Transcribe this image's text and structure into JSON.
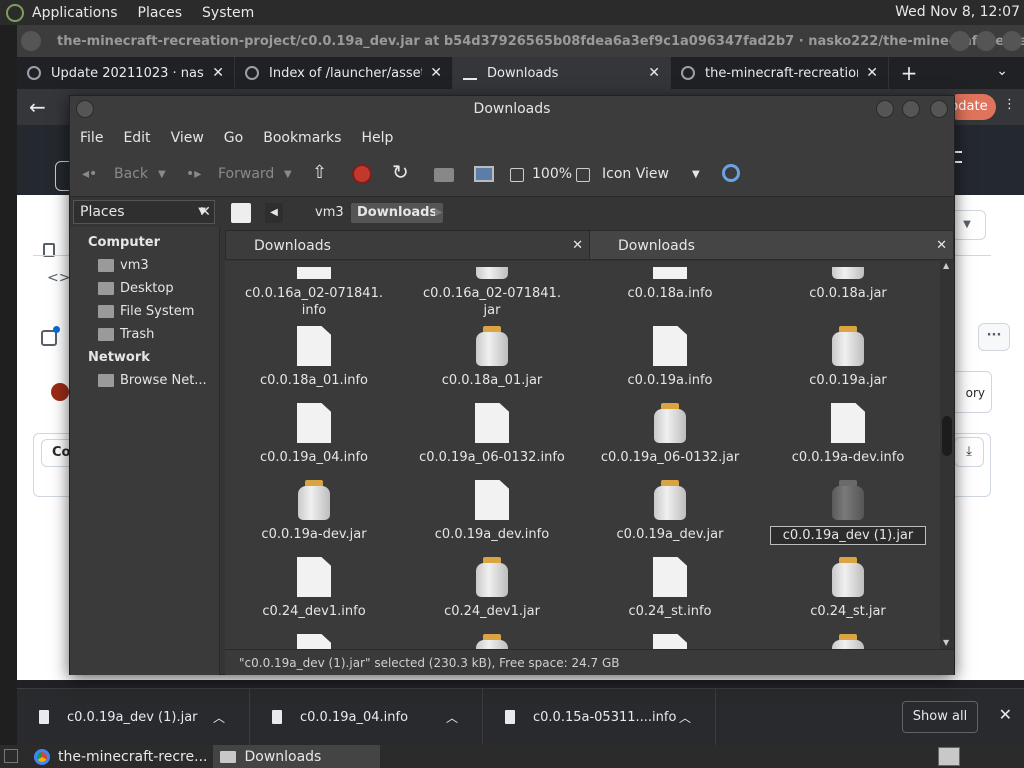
{
  "top_panel": {
    "menus": [
      "Applications",
      "Places",
      "System"
    ],
    "clock": "Wed Nov 8, 12:07"
  },
  "browser": {
    "window_title": "the-minecraft-recreation-project/c0.0.19a_dev.jar at b54d37926565b08fdea6a3ef9c1a096347fad2b7 · nasko222/the-minecraft-recreation-pr...",
    "tabs": [
      {
        "label": "Update 20211023 · nasko22"
      },
      {
        "label": "Index of /launcher/assets/js"
      },
      {
        "label": "Downloads"
      },
      {
        "label": "the-minecraft-recreation-"
      }
    ],
    "update_label": "pdate",
    "story_label": "ory",
    "code_label": "Co"
  },
  "downloads_bar": {
    "items": [
      {
        "name": "c0.0.19a_dev (1).jar"
      },
      {
        "name": "c0.0.19a_04.info"
      },
      {
        "name": "c0.0.15a-05311....info"
      }
    ],
    "show_all": "Show all"
  },
  "taskbar": {
    "items": [
      "the-minecraft-recre...",
      "Downloads"
    ]
  },
  "nautilus": {
    "title": "Downloads",
    "menu": [
      "File",
      "Edit",
      "View",
      "Go",
      "Bookmarks",
      "Help"
    ],
    "toolbar": {
      "back": "Back",
      "forward": "Forward",
      "zoom": "100%",
      "view_mode": "Icon View"
    },
    "sidebar": {
      "header": "Places",
      "computer_heading": "Computer",
      "computer_items": [
        "vm3",
        "Desktop",
        "File System",
        "Trash"
      ],
      "network_heading": "Network",
      "network_items": [
        "Browse Net..."
      ]
    },
    "location": {
      "parent": "vm3",
      "current": "Downloads"
    },
    "pane_tabs": [
      "Downloads",
      "Downloads"
    ],
    "files": [
      {
        "name": "c0.0.16a_02-071841.\ninfo",
        "kind": "doc"
      },
      {
        "name": "c0.0.16a_02-071841.\njar",
        "kind": "jar"
      },
      {
        "name": "c0.0.18a.info",
        "kind": "doc"
      },
      {
        "name": "c0.0.18a.jar",
        "kind": "jar"
      },
      {
        "name": "c0.0.18a_01.info",
        "kind": "doc"
      },
      {
        "name": "c0.0.18a_01.jar",
        "kind": "jar"
      },
      {
        "name": "c0.0.19a.info",
        "kind": "doc"
      },
      {
        "name": "c0.0.19a.jar",
        "kind": "jar"
      },
      {
        "name": "c0.0.19a_04.info",
        "kind": "doc"
      },
      {
        "name": "c0.0.19a_06-0132.info",
        "kind": "doc"
      },
      {
        "name": "c0.0.19a_06-0132.jar",
        "kind": "jar"
      },
      {
        "name": "c0.0.19a-dev.info",
        "kind": "doc"
      },
      {
        "name": "c0.0.19a-dev.jar",
        "kind": "jar"
      },
      {
        "name": "c0.0.19a_dev.info",
        "kind": "doc"
      },
      {
        "name": "c0.0.19a_dev.jar",
        "kind": "jar"
      },
      {
        "name": "c0.0.19a_dev (1).jar",
        "kind": "jar",
        "selected": true
      },
      {
        "name": "c0.24_dev1.info",
        "kind": "doc"
      },
      {
        "name": "c0.24_dev1.jar",
        "kind": "jar"
      },
      {
        "name": "c0.24_st.info",
        "kind": "doc"
      },
      {
        "name": "c0.24_st.jar",
        "kind": "jar"
      },
      {
        "name": "",
        "kind": "doc"
      },
      {
        "name": "",
        "kind": "jar"
      },
      {
        "name": "",
        "kind": "doc"
      },
      {
        "name": "",
        "kind": "jar"
      }
    ],
    "status": "\"c0.0.19a_dev (1).jar\" selected (230.3 kB), Free space: 24.7 GB"
  }
}
